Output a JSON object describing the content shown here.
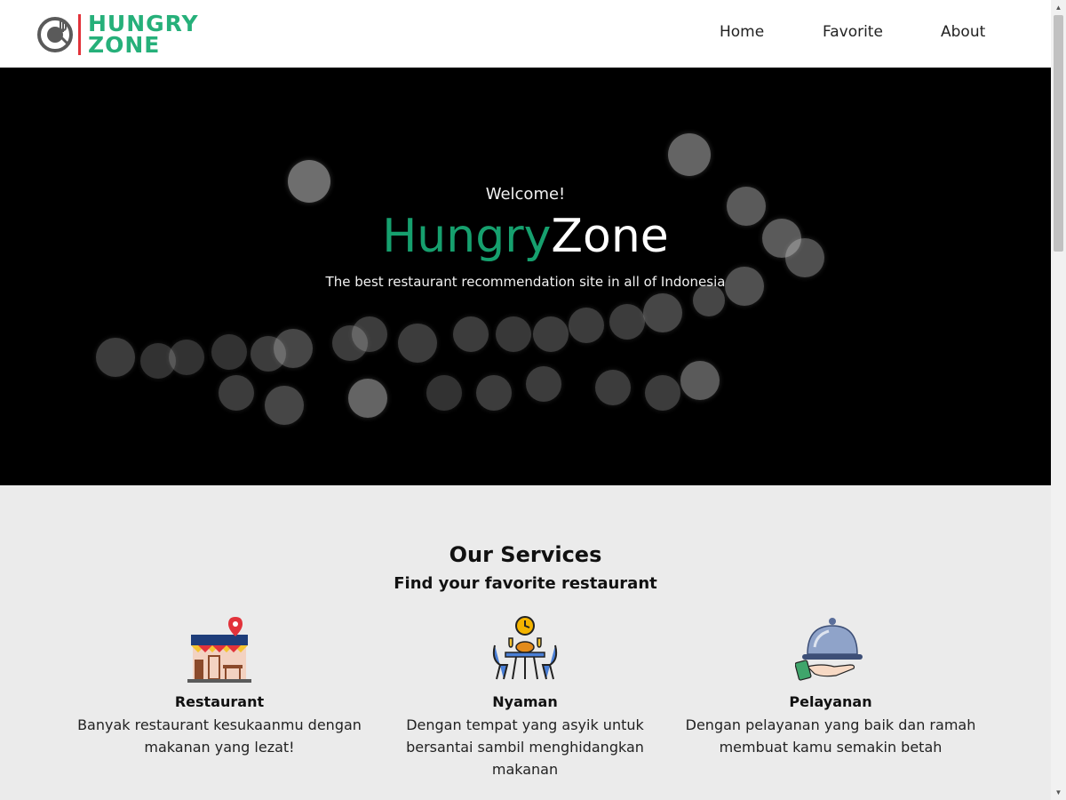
{
  "header": {
    "logo_line1": "HUNGRY",
    "logo_line2": "ZONE",
    "nav": [
      "Home",
      "Favorite",
      "About"
    ]
  },
  "hero": {
    "welcome": "Welcome!",
    "title_part1": "Hungry",
    "title_part2": "Zone",
    "tagline": "The best restaurant recommendation site in all of Indonesia"
  },
  "services": {
    "title": "Our Services",
    "subtitle": "Find your favorite restaurant",
    "items": [
      {
        "name": "Restaurant",
        "description": "Banyak restaurant kesukaanmu dengan makanan yang lezat!",
        "icon": "restaurant-icon"
      },
      {
        "name": "Nyaman",
        "description": "Dengan tempat yang asyik untuk bersantai sambil menghidangkan makanan",
        "icon": "dining-table-icon"
      },
      {
        "name": "Pelayanan",
        "description": "Dengan pelayanan yang baik dan ramah membuat kamu semakin betah",
        "icon": "serving-cloche-icon"
      }
    ]
  },
  "colors": {
    "brand_green": "#26b07a",
    "hero_green": "#16a06e",
    "logo_red": "#e2323a",
    "hero_bg": "#000000",
    "services_bg": "#ebebeb"
  }
}
